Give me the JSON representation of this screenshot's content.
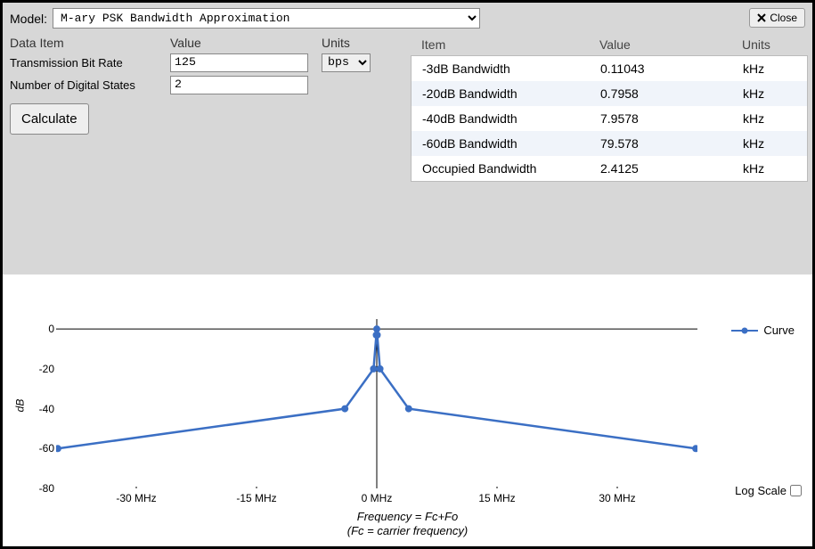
{
  "model_label": "Model:",
  "model_value": "M-ary PSK Bandwidth Approximation",
  "close_label": "Close",
  "headers": {
    "data_item": "Data Item",
    "value": "Value",
    "units": "Units"
  },
  "inputs": [
    {
      "label": "Transmission Bit Rate",
      "value": "125",
      "units": "bps"
    },
    {
      "label": "Number of Digital States",
      "value": "2",
      "units": ""
    }
  ],
  "calculate_label": "Calculate",
  "result_headers": {
    "item": "Item",
    "value": "Value",
    "units": "Units"
  },
  "results": [
    {
      "item": "-3dB Bandwidth",
      "value": "0.11043",
      "units": "kHz"
    },
    {
      "item": "-20dB Bandwidth",
      "value": "0.7958",
      "units": "kHz"
    },
    {
      "item": "-40dB Bandwidth",
      "value": "7.9578",
      "units": "kHz"
    },
    {
      "item": "-60dB Bandwidth",
      "value": "79.578",
      "units": "kHz"
    },
    {
      "item": "Occupied Bandwidth",
      "value": "2.4125",
      "units": "kHz"
    }
  ],
  "chart_data": {
    "type": "line",
    "series": [
      {
        "name": "Curve",
        "x": [
          -39.789,
          -3.9789,
          -0.3979,
          -0.055215,
          0,
          0.055215,
          0.3979,
          3.9789,
          39.789
        ],
        "y": [
          -60,
          -40,
          -20,
          -3,
          0,
          -3,
          -20,
          -40,
          -60
        ]
      }
    ],
    "xlabel": "Frequency = Fc+Fo",
    "xlabel_sub": "(Fc = carrier frequency)",
    "ylabel": "dB",
    "xlim": [
      -40,
      40
    ],
    "ylim": [
      -80,
      5
    ],
    "x_ticks": [
      -30,
      -15,
      0,
      15,
      30
    ],
    "x_tick_labels": [
      "-30 MHz",
      "-15 MHz",
      "0 MHz",
      "15 MHz",
      "30 MHz"
    ],
    "y_ticks": [
      0,
      -20,
      -40,
      -60,
      -80
    ],
    "legend": "Curve",
    "log_scale_label": "Log Scale",
    "color": "#3b6fc4"
  }
}
